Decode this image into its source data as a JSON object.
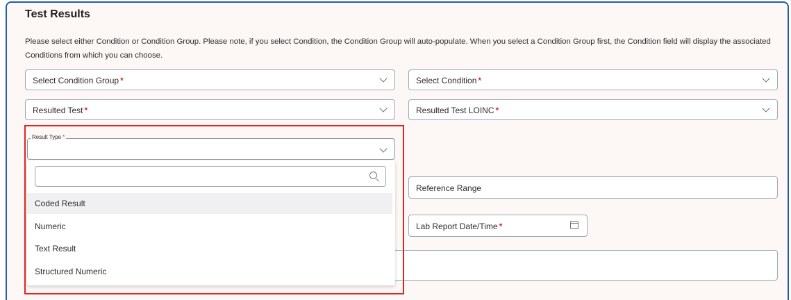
{
  "section": {
    "title": "Test Results",
    "description": "Please select either Condition or Condition Group. Please note, if you select Condition, the Condition Group will auto-populate. When you select a Condition Group first, the Condition field will display the associated Conditions from which you can choose."
  },
  "fields": {
    "condition_group": {
      "label": "Select Condition Group",
      "required_mark": "*"
    },
    "condition": {
      "label": "Select Condition",
      "required_mark": "*"
    },
    "resulted_test": {
      "label": "Resulted Test",
      "required_mark": "*"
    },
    "resulted_test_loinc": {
      "label": "Resulted Test LOINC",
      "required_mark": "*"
    },
    "result_type": {
      "label": "Result Type",
      "required_mark": "*",
      "value": ""
    },
    "reference_range": {
      "label": "Reference Range"
    },
    "lab_report_datetime": {
      "label": "Lab Report Date/Time",
      "required_mark": "*"
    }
  },
  "result_type_dropdown": {
    "search_value": "",
    "options": [
      "Coded Result",
      "Numeric",
      "Text Result",
      "Structured Numeric"
    ],
    "highlighted_index": 0
  },
  "colors": {
    "panel_border": "#1f5fa8",
    "panel_bg": "#fdf8f6",
    "required": "#d32f2f",
    "highlight_outline": "#e0241c"
  },
  "icons": {
    "dropdown": "chevron-down-icon",
    "search": "search-icon",
    "calendar": "calendar-icon"
  }
}
